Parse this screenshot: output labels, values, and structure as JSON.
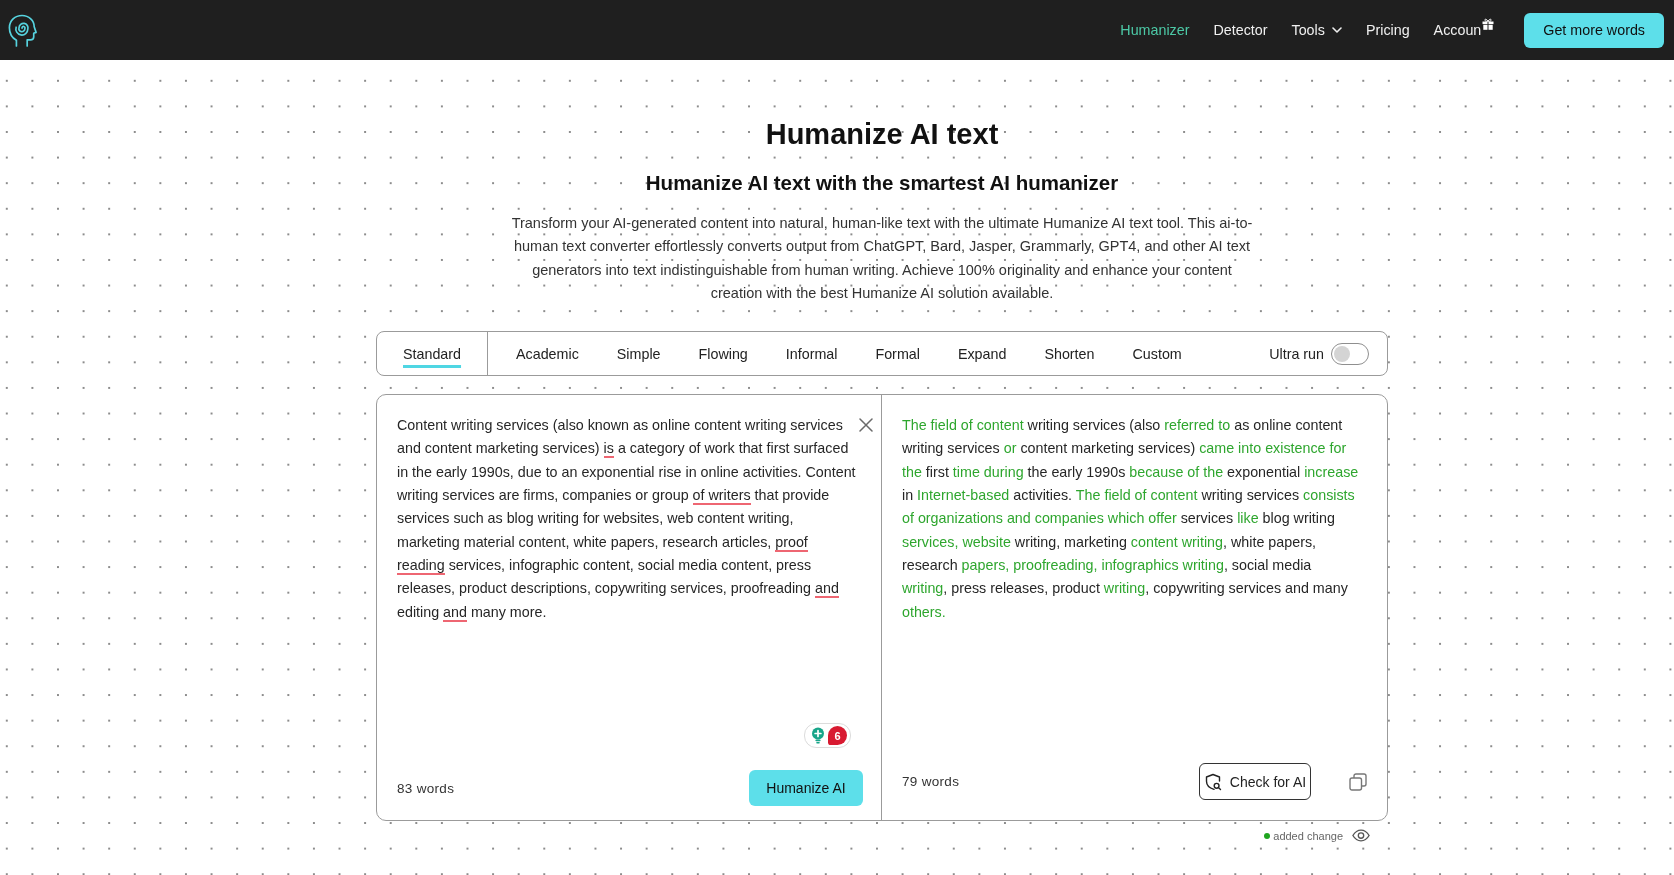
{
  "navbar": {
    "items": [
      {
        "label": "Humanizer",
        "kind": "link",
        "selected": true
      },
      {
        "label": "Detector",
        "kind": "link",
        "selected": false
      },
      {
        "label": "Tools",
        "kind": "menu",
        "selected": false
      },
      {
        "label": "Pricing",
        "kind": "link",
        "selected": false
      },
      {
        "label": "Accoun",
        "kind": "gift",
        "selected": false
      }
    ],
    "cta": "Get more words"
  },
  "hero": {
    "title": "Humanize AI text",
    "subtitle": "Humanize AI text with the smartest AI humanizer",
    "description": "Transform your AI-generated content into natural, human-like text with the ultimate Humanize AI text tool. This ai-to-human text converter effortlessly converts output from ChatGPT, Bard, Jasper, Grammarly, GPT4, and other AI text generators into text indistinguishable from human writing. Achieve 100% originality and enhance your content creation with the best Humanize AI solution available."
  },
  "modes": {
    "tabs": [
      {
        "label": "Standard",
        "selected": true
      },
      {
        "label": "Academic",
        "selected": false
      },
      {
        "label": "Simple",
        "selected": false
      },
      {
        "label": "Flowing",
        "selected": false
      },
      {
        "label": "Informal",
        "selected": false
      },
      {
        "label": "Formal",
        "selected": false
      },
      {
        "label": "Expand",
        "selected": false
      },
      {
        "label": "Shorten",
        "selected": false
      },
      {
        "label": "Custom",
        "selected": false
      }
    ],
    "ultra_run": {
      "label": "Ultra run",
      "on": false
    }
  },
  "input_panel": {
    "segments": [
      {
        "text": "Content writing services (also known as online content writing services and content marketing services) ",
        "flagged": false
      },
      {
        "text": "is",
        "flagged": true
      },
      {
        "text": " a category of work that first surfaced in the early 1990s, due to an exponential rise in online activities. Content writing services are firms, companies or group ",
        "flagged": false
      },
      {
        "text": "of writers",
        "flagged": true
      },
      {
        "text": " that provide services such as blog writing for websites, web content writing, marketing material content, white papers, research articles, ",
        "flagged": false
      },
      {
        "text": "proof reading",
        "flagged": true
      },
      {
        "text": " services, infographic content, social media content, press releases, product descriptions, copywriting services, proofreading ",
        "flagged": false
      },
      {
        "text": "and",
        "flagged": true
      },
      {
        "text": " editing ",
        "flagged": false
      },
      {
        "text": "and",
        "flagged": true
      },
      {
        "text": " many more.",
        "flagged": false
      }
    ],
    "issue_count": "6",
    "word_count": "83 words",
    "button": "Humanize AI"
  },
  "output_panel": {
    "segments": [
      {
        "text": "The field of content",
        "changed": true
      },
      {
        "text": " writing services (also ",
        "changed": false
      },
      {
        "text": "referred to",
        "changed": true
      },
      {
        "text": " as online content writing services ",
        "changed": false
      },
      {
        "text": "or",
        "changed": true
      },
      {
        "text": " content marketing services) ",
        "changed": false
      },
      {
        "text": "came into existence for the",
        "changed": true
      },
      {
        "text": " first ",
        "changed": false
      },
      {
        "text": "time during",
        "changed": true
      },
      {
        "text": " the early 1990s ",
        "changed": false
      },
      {
        "text": "because of the",
        "changed": true
      },
      {
        "text": " exponential ",
        "changed": false
      },
      {
        "text": "increase",
        "changed": true
      },
      {
        "text": " in ",
        "changed": false
      },
      {
        "text": "Internet-based",
        "changed": true
      },
      {
        "text": " activities. ",
        "changed": false
      },
      {
        "text": "The field of content",
        "changed": true
      },
      {
        "text": " writing services ",
        "changed": false
      },
      {
        "text": "consists of organizations and companies which offer",
        "changed": true
      },
      {
        "text": " services ",
        "changed": false
      },
      {
        "text": "like",
        "changed": true
      },
      {
        "text": " blog writing ",
        "changed": false
      },
      {
        "text": "services, website",
        "changed": true
      },
      {
        "text": " writing, marketing ",
        "changed": false
      },
      {
        "text": "content writing",
        "changed": true
      },
      {
        "text": ", white papers, research ",
        "changed": false
      },
      {
        "text": "papers, proofreading, infographics writing",
        "changed": true
      },
      {
        "text": ", social media ",
        "changed": false
      },
      {
        "text": "writing",
        "changed": true
      },
      {
        "text": ", press releases, product ",
        "changed": false
      },
      {
        "text": "writing",
        "changed": true
      },
      {
        "text": ", copywriting services and many ",
        "changed": false
      },
      {
        "text": "others.",
        "changed": true
      }
    ],
    "word_count": "79 words",
    "button": "Check for AI"
  },
  "legend": {
    "label": "added change"
  }
}
